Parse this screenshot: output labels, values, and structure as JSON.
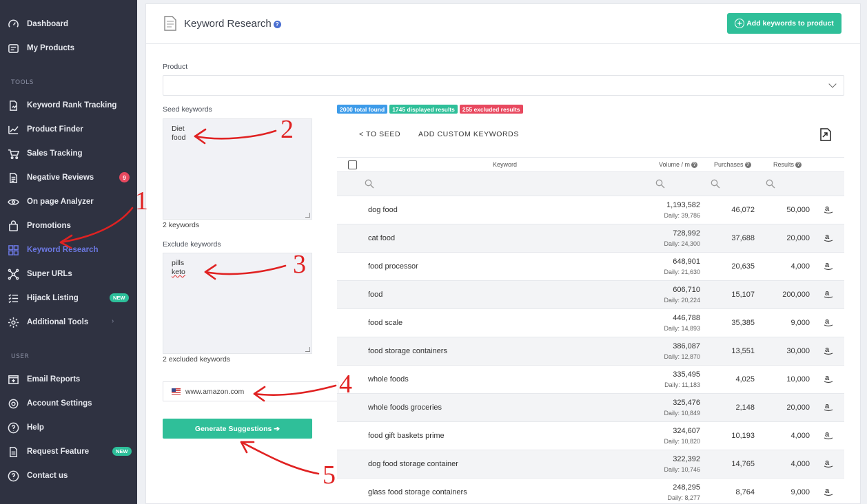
{
  "sidebar": {
    "items": [
      {
        "label": "Dashboard",
        "icon": "gauge-icon"
      },
      {
        "label": "My Products",
        "icon": "products-icon"
      },
      {
        "label": "Keyword Rank Tracking",
        "icon": "rank-tracking-icon"
      },
      {
        "label": "Product Finder",
        "icon": "chart-line-icon"
      },
      {
        "label": "Sales Tracking",
        "icon": "cart-icon"
      },
      {
        "label": "Negative Reviews",
        "icon": "document-icon",
        "badge": "9"
      },
      {
        "label": "On page Analyzer",
        "icon": "eye-icon"
      },
      {
        "label": "Promotions",
        "icon": "bag-icon"
      },
      {
        "label": "Keyword Research",
        "icon": "keyword-research-icon"
      },
      {
        "label": "Super URLs",
        "icon": "network-icon"
      },
      {
        "label": "Hijack Listing",
        "icon": "list-icon",
        "badge": "NEW"
      },
      {
        "label": "Additional Tools",
        "icon": "gear-icon",
        "chevron": "›"
      },
      {
        "label": "Email Reports",
        "icon": "email-report-icon"
      },
      {
        "label": "Account Settings",
        "icon": "settings-icon"
      },
      {
        "label": "Help",
        "icon": "question-icon"
      },
      {
        "label": "Request Feature",
        "icon": "request-icon",
        "badge": "NEW"
      },
      {
        "label": "Contact us",
        "icon": "contact-icon"
      }
    ],
    "section_tools": "TOOLS",
    "section_user": "USER",
    "active_item": "Keyword Research"
  },
  "header": {
    "title": "Keyword Research",
    "help": "?",
    "add_button": "Add keywords to product"
  },
  "form": {
    "product_label": "Product",
    "product_value": "",
    "seed_label": "Seed keywords",
    "seed_lines": [
      "Diet",
      "food"
    ],
    "seed_count": "2 keywords",
    "exclude_label": "Exclude keywords",
    "exclude_lines": [
      "pills",
      "keto"
    ],
    "exclude_count": "2 excluded keywords",
    "marketplace": "www.amazon.com",
    "generate_button": "Generate Suggestions ➔"
  },
  "results": {
    "tags": [
      {
        "text": "2000 total found",
        "color": "#3d9be9"
      },
      {
        "text": "1745 displayed results",
        "color": "#2fbf99"
      },
      {
        "text": "255 excluded results",
        "color": "#e8495f"
      }
    ],
    "to_seed": "< TO SEED",
    "add_custom": "ADD CUSTOM KEYWORDS",
    "columns": {
      "keyword": "Keyword",
      "volume": "Volume / m",
      "purchases": "Purchases",
      "results": "Results"
    },
    "rows": [
      {
        "keyword": "dog food",
        "volume": "1,193,582",
        "daily": "Daily: 39,786",
        "purchases": "46,072",
        "results": "50,000"
      },
      {
        "keyword": "cat food",
        "volume": "728,992",
        "daily": "Daily: 24,300",
        "purchases": "37,688",
        "results": "20,000"
      },
      {
        "keyword": "food processor",
        "volume": "648,901",
        "daily": "Daily: 21,630",
        "purchases": "20,635",
        "results": "4,000"
      },
      {
        "keyword": "food",
        "volume": "606,710",
        "daily": "Daily: 20,224",
        "purchases": "15,107",
        "results": "200,000"
      },
      {
        "keyword": "food scale",
        "volume": "446,788",
        "daily": "Daily: 14,893",
        "purchases": "35,385",
        "results": "9,000"
      },
      {
        "keyword": "food storage containers",
        "volume": "386,087",
        "daily": "Daily: 12,870",
        "purchases": "13,551",
        "results": "30,000"
      },
      {
        "keyword": "whole foods",
        "volume": "335,495",
        "daily": "Daily: 11,183",
        "purchases": "4,025",
        "results": "10,000"
      },
      {
        "keyword": "whole foods groceries",
        "volume": "325,476",
        "daily": "Daily: 10,849",
        "purchases": "2,148",
        "results": "20,000"
      },
      {
        "keyword": "food gift baskets prime",
        "volume": "324,607",
        "daily": "Daily: 10,820",
        "purchases": "10,193",
        "results": "4,000"
      },
      {
        "keyword": "dog food storage container",
        "volume": "322,392",
        "daily": "Daily: 10,746",
        "purchases": "14,765",
        "results": "4,000"
      },
      {
        "keyword": "glass food storage containers",
        "volume": "248,295",
        "daily": "Daily: 8,277",
        "purchases": "8,764",
        "results": "9,000"
      }
    ]
  },
  "annotations": [
    "1",
    "2",
    "3",
    "4",
    "5"
  ]
}
